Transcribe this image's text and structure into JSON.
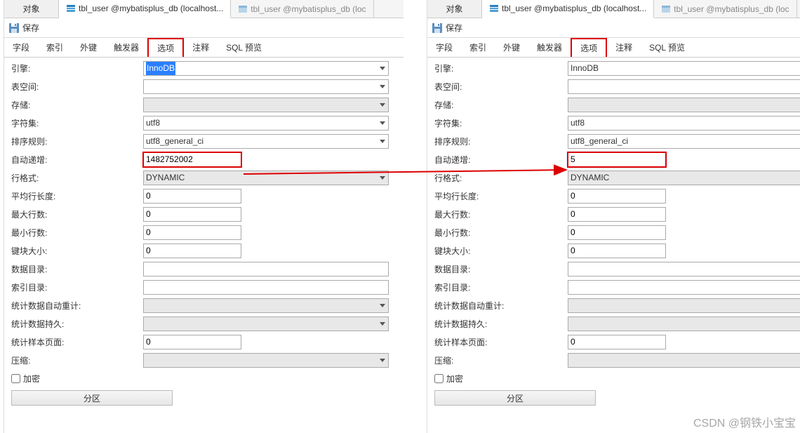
{
  "common": {
    "objectTab": "对象",
    "activeTab": "tbl_user @mybatisplus_db (localhost...",
    "inactiveTab": "tbl_user @mybatisplus_db (loc",
    "inactiveTabRight": "tbl_user @mybatisplus_db (loc",
    "saveLabel": "保存",
    "navtabs": [
      "字段",
      "索引",
      "外键",
      "触发器",
      "选项",
      "注释",
      "SQL 预览"
    ],
    "labels": {
      "engine": "引擎:",
      "tablespace": "表空间:",
      "storage": "存储:",
      "charset": "字符集:",
      "collation": "排序规则:",
      "autoinc": "自动递增:",
      "rowformat": "行格式:",
      "avgrowlen": "平均行长度:",
      "maxrows": "最大行数:",
      "minrows": "最小行数:",
      "keyblock": "键块大小:",
      "datadir": "数据目录:",
      "indexdir": "索引目录:",
      "statsauto": "统计数据自动重计:",
      "statspersist": "统计数据持久:",
      "statssample": "统计样本页面:",
      "compress": "压缩:",
      "encrypt": "加密",
      "partbtn": "分区"
    },
    "values": {
      "engine": "InnoDB",
      "charset": "utf8",
      "collation": "utf8_general_ci",
      "rowformat": "DYNAMIC",
      "avgrowlen": "0",
      "maxrows": "0",
      "minrows": "0",
      "keyblock": "0",
      "statssample": "0"
    }
  },
  "left": {
    "autoinc": "1482752002"
  },
  "right": {
    "autoinc": "5"
  },
  "watermark": "CSDN @钢铁小宝宝"
}
